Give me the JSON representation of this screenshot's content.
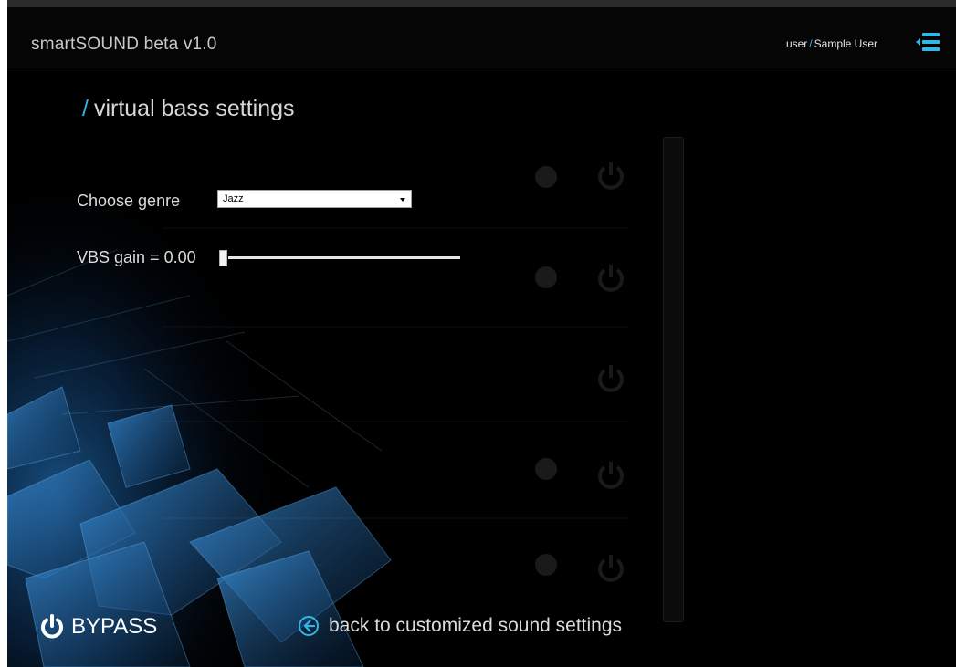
{
  "header": {
    "app_title": "smartSOUND beta v1.0",
    "user_label": "user",
    "user_separator": "/",
    "user_name": "Sample User",
    "menu_icon": "menu-list-icon"
  },
  "page": {
    "heading_slash": "/",
    "heading": "virtual bass settings"
  },
  "settings": {
    "genre_label": "Choose genre",
    "genre_value": "Jazz",
    "gain_label": "VBS gain = 0.00",
    "gain_value": 0.0
  },
  "footer": {
    "bypass_label": "BYPASS",
    "back_label": "back to customized sound settings"
  },
  "colors": {
    "accent": "#2fb8e6",
    "background": "#000000",
    "text": "#dcdcdc"
  }
}
